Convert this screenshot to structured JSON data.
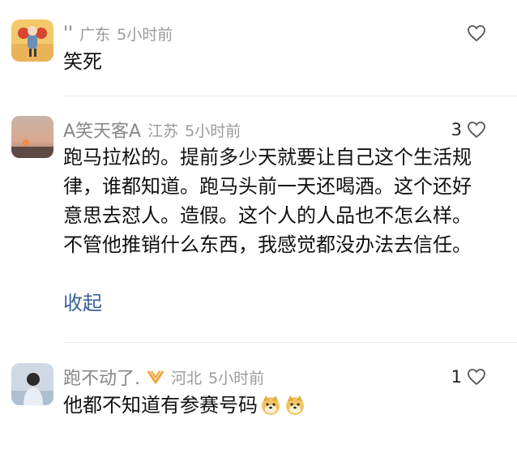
{
  "comments": [
    {
      "name": "''",
      "location": "广东",
      "time": "5小时前",
      "likes": "",
      "text": "笑死",
      "avatar_icon": "cartoon-avatar"
    },
    {
      "name": "A笑天客A",
      "location": "江苏",
      "time": "5小时前",
      "likes": "3",
      "text": "跑马拉松的。提前多少天就要让自己这个生活规律，谁都知道。跑马头前一天还喝酒。这个还好意思去怼人。造假。这个人的人品也不怎么样。不管他推销什么东西，我感觉都没办法去信任。",
      "collapse_label": "收起",
      "avatar_icon": "sunset-avatar"
    },
    {
      "name": "跑不动了.",
      "location": "河北",
      "time": "5小时前",
      "likes": "1",
      "text": "他都不知道有参赛号码",
      "badge_icon": "vip-badge-icon",
      "avatar_icon": "portrait-avatar",
      "emojis": [
        "doge-emoji",
        "doge-emoji"
      ]
    }
  ],
  "colors": {
    "name": "#888888",
    "meta": "#9a9a9a",
    "text": "#111111",
    "link": "#3a5f97",
    "badge": "#f0a53a"
  }
}
